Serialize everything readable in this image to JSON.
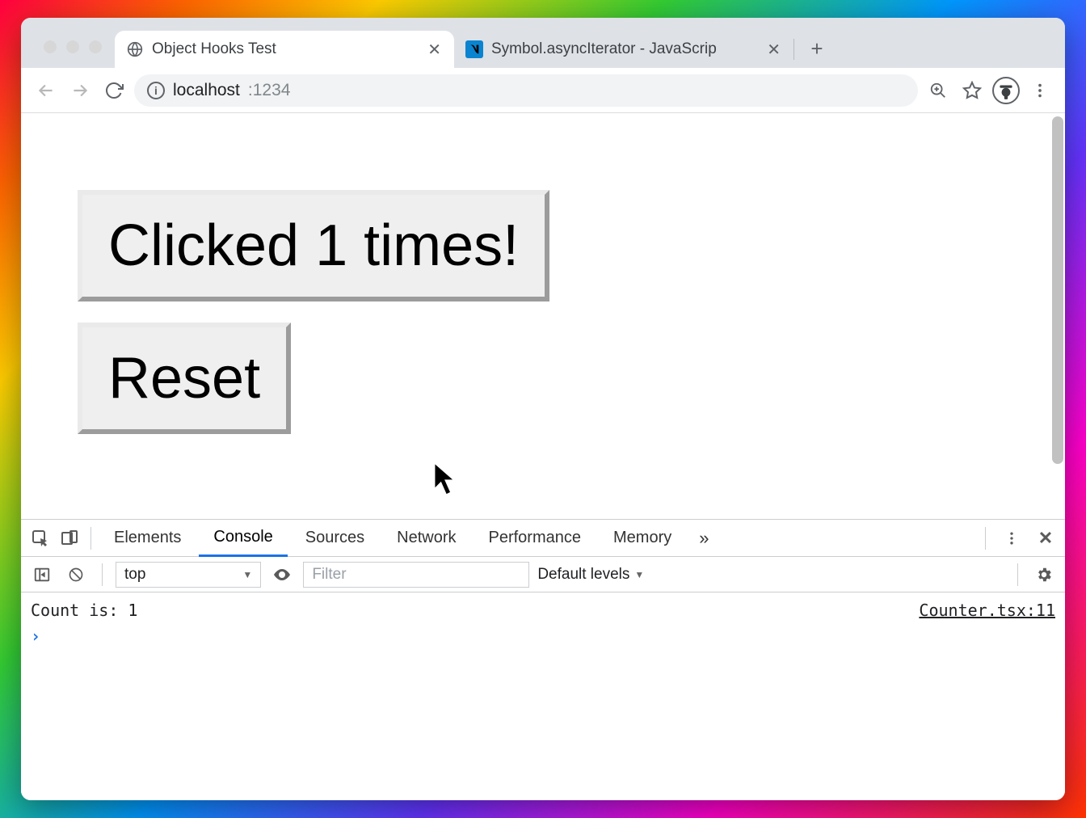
{
  "tabs": [
    {
      "title": "Object Hooks Test",
      "active": true,
      "favicon": "globe"
    },
    {
      "title": "Symbol.asyncIterator - JavaScrip",
      "active": false,
      "favicon": "mdn"
    }
  ],
  "addressbar": {
    "host": "localhost",
    "port": ":1234"
  },
  "page": {
    "clicked_button_label": "Clicked 1 times!",
    "reset_button_label": "Reset"
  },
  "devtools": {
    "tabs": {
      "elements": "Elements",
      "console": "Console",
      "sources": "Sources",
      "network": "Network",
      "performance": "Performance",
      "memory": "Memory",
      "more": "»"
    },
    "active_tab": "Console",
    "context_selector": "top",
    "filter_placeholder": "Filter",
    "levels_label": "Default levels",
    "console_log": {
      "message": "Count is: 1",
      "source": "Counter.tsx:11"
    },
    "prompt": ">"
  }
}
